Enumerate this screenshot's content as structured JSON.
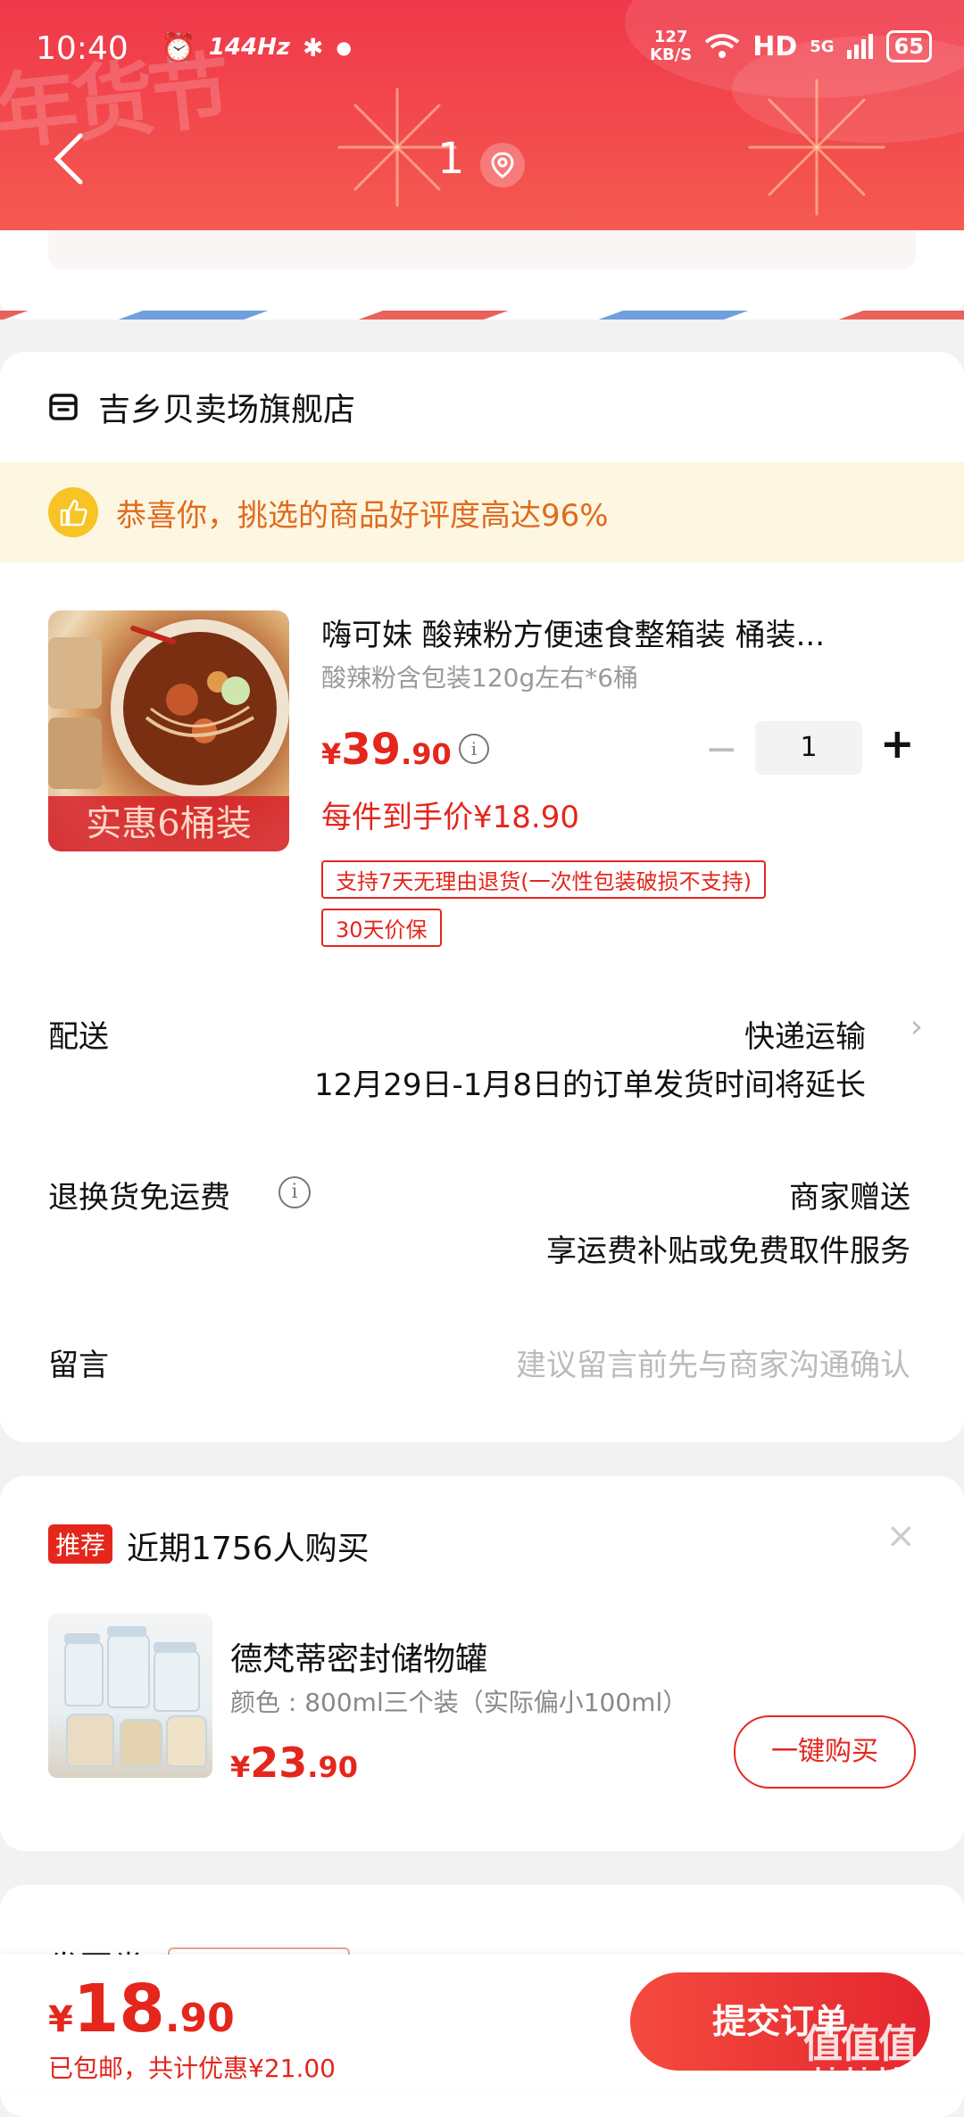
{
  "status_bar": {
    "time": "10:40",
    "refresh_rate": "144Hz",
    "net_speed_value": "127",
    "net_speed_unit": "KB/S",
    "hd_label": "HD",
    "network_label": "5G",
    "battery": "65"
  },
  "header": {
    "title": "1",
    "banner_text": "年货节",
    "colors": {
      "primary": "#f0384a",
      "accent": "#e4261c"
    }
  },
  "shop": {
    "name": "吉乡贝卖场旗舰店",
    "praise": "恭喜你，挑选的商品好评度高达96%"
  },
  "product": {
    "image_badge": "实惠6桶装",
    "title": "嗨可妹 酸辣粉方便速食整箱装 桶装...",
    "spec": "酸辣粉含包装120g左右*6桶",
    "price_symbol": "¥",
    "price_int": "39",
    "price_dec": ".90",
    "quantity": "1",
    "minus_label": "−",
    "plus_label": "+",
    "per_item_price": "每件到手价¥18.90",
    "tags": [
      "支持7天无理由退货(一次性包装破损不支持)",
      "30天价保"
    ]
  },
  "delivery": {
    "label": "配送",
    "method": "快递运输",
    "note": "12月29日-1月8日的订单发货时间将延长"
  },
  "return_shipping": {
    "label": "退换货免运费",
    "value": "商家赠送",
    "note": "享运费补贴或免费取件服务"
  },
  "message": {
    "label": "留言",
    "placeholder": "建议留言前先与商家沟通确认"
  },
  "recommend": {
    "badge": "推荐",
    "title": "近期1756人购买",
    "close": "×",
    "item_name": "德梵蒂密封储物罐",
    "item_spec": "颜色 : 800ml三个装（实际偏小100ml）",
    "price_symbol": "¥",
    "price_int": "23",
    "price_dec": ".90",
    "buy_label": "一键购买"
  },
  "partial": {
    "text": "发票类"
  },
  "footer": {
    "price_symbol": "¥",
    "price_int": "18",
    "price_dec": ".90",
    "summary": "已包邮，共计优惠¥21.00",
    "submit_label": "提交订单",
    "watermark_big": "值值值",
    "watermark_small": "zhizhizhi.com"
  }
}
